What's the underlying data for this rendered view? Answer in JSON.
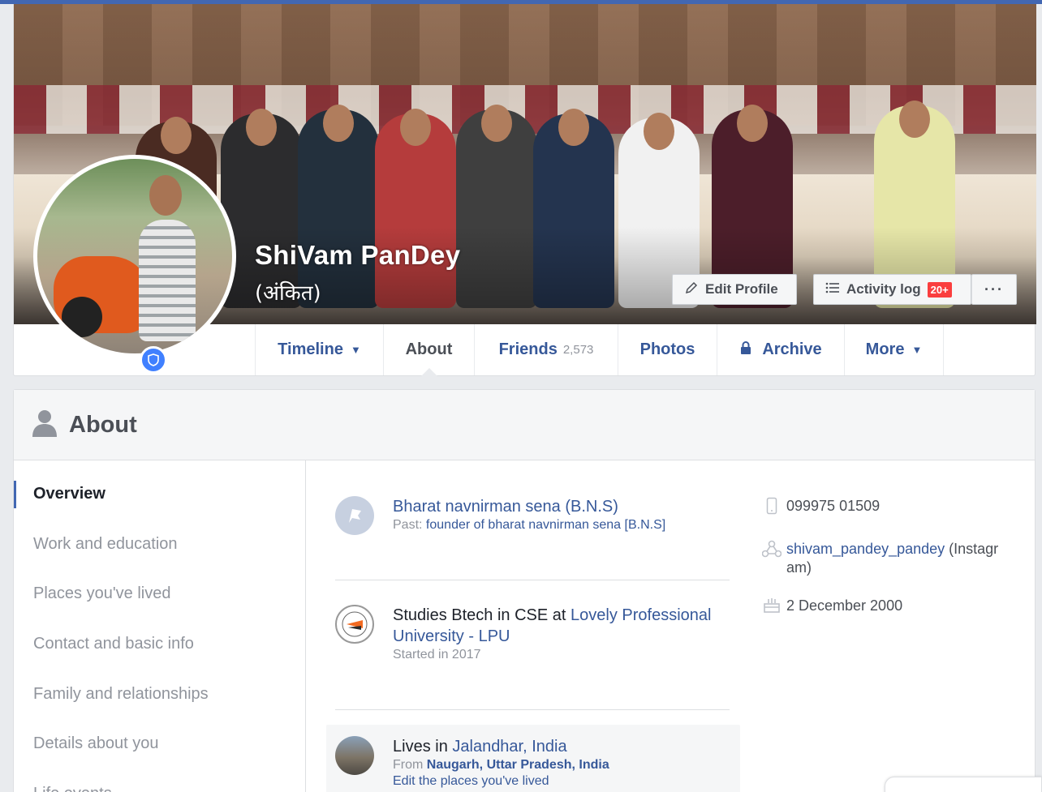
{
  "profile": {
    "name": "ShiVam PanDey",
    "alternate_name": "(अंकित)",
    "edit_profile": "Edit Profile",
    "activity_log": "Activity log",
    "activity_badge": "20+",
    "more_dots": "···"
  },
  "tabs": [
    {
      "label": "Timeline",
      "caret": "▼"
    },
    {
      "label": "About"
    },
    {
      "label": "Friends",
      "count": "2,573"
    },
    {
      "label": "Photos"
    },
    {
      "label": "Archive"
    },
    {
      "label": "More",
      "caret": "▼"
    }
  ],
  "about": {
    "title": "About",
    "nav": [
      "Overview",
      "Work and education",
      "Places you've lived",
      "Contact and basic info",
      "Family and relationships",
      "Details about you",
      "Life events"
    ],
    "entries": {
      "work": {
        "org": "Bharat navnirman sena (B.N.S)",
        "past_label": "Past:",
        "role": "founder of bharat navnirman sena [B.N.S]"
      },
      "education": {
        "prefix": "Studies Btech in CSE at",
        "school": "Lovely Professional University - LPU",
        "started": "Started in 2017"
      },
      "places": {
        "prefix": "Lives in",
        "city": "Jalandhar, India",
        "from_label": "From",
        "hometown": "Naugarh, Uttar Pradesh, India",
        "edit_link": "Edit the places you've lived"
      }
    },
    "contact": {
      "phone": "099975 01509",
      "instagram_handle": "shivam_pandey_pandey",
      "instagram_suffix": " (Instagr am)",
      "birthday": "2 December 2000"
    }
  },
  "colors": {
    "brand": "#4267b2",
    "link": "#365899",
    "badge": "#fa3e3e"
  },
  "icons": {
    "edit": "pencil-icon",
    "activity": "list-icon",
    "archive": "lock-icon",
    "about": "person-icon",
    "work": "flag-icon",
    "phone": "phone-icon",
    "instagram": "network-icon",
    "birthday": "cake-icon",
    "shield": "shield-icon"
  }
}
